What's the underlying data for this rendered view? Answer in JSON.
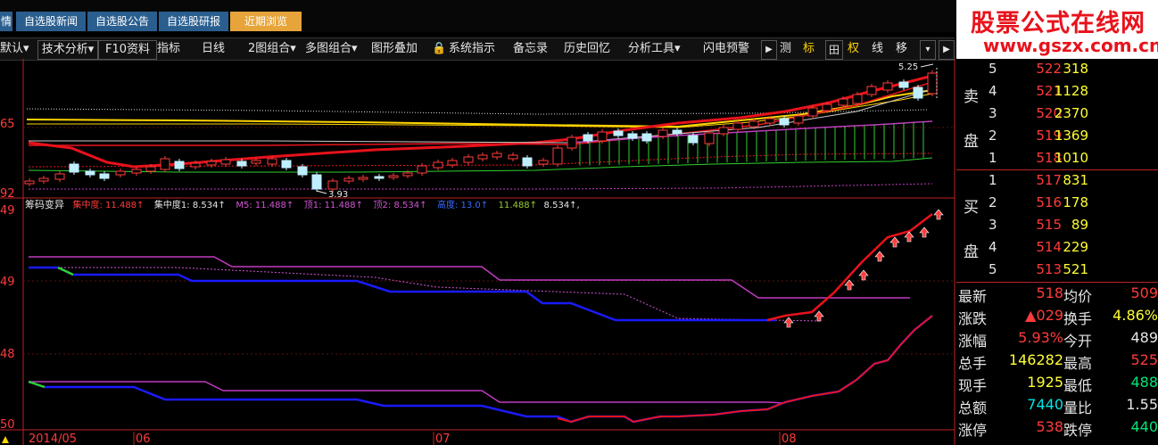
{
  "tabs": [
    {
      "label": "情"
    },
    {
      "label": "自选股新闻"
    },
    {
      "label": "自选股公告"
    },
    {
      "label": "自选股研报"
    },
    {
      "label": "近期浏览",
      "active": true
    }
  ],
  "toolbar": [
    {
      "label": "默认▾",
      "kind": "plain"
    },
    {
      "label": "技术分析▾",
      "kind": "plain"
    },
    {
      "label": "F10资料",
      "kind": "plain"
    },
    {
      "label": "指标",
      "kind": "plain"
    },
    {
      "label": "日线",
      "kind": "plain"
    },
    {
      "label": "2图组合▾",
      "kind": "plain"
    },
    {
      "label": "多图组合▾",
      "kind": "plain"
    },
    {
      "label": "图形叠加",
      "kind": "plain"
    },
    {
      "label": "🔒",
      "kind": "plain"
    },
    {
      "label": "系统指示",
      "kind": "plain"
    },
    {
      "label": "备忘录",
      "kind": "plain"
    },
    {
      "label": "历史回忆",
      "kind": "plain"
    },
    {
      "label": "分析工具▾",
      "kind": "plain"
    },
    {
      "label": "闪电预警",
      "kind": "plain"
    },
    {
      "label": "▶",
      "kind": "boxed"
    },
    {
      "label": "测",
      "kind": "plain"
    },
    {
      "label": "标",
      "kind": "hl"
    },
    {
      "label": "田",
      "kind": "boxed"
    },
    {
      "label": "权",
      "kind": "hl"
    },
    {
      "label": "线",
      "kind": "plain"
    },
    {
      "label": "移",
      "kind": "plain"
    },
    {
      "label": "▾",
      "kind": "boxed"
    },
    {
      "label": "▶",
      "kind": "boxed"
    }
  ],
  "watermark": {
    "title": "股票公式在线网",
    "url": "www.gszx.com.cn"
  },
  "price_chart": {
    "high_label": "5.25",
    "low_label": "3.93",
    "axis_labels": [
      "65",
      "92"
    ]
  },
  "indicator": {
    "name": "筹码变异",
    "legend": [
      {
        "text": "集中度: 11.488↑",
        "color": "#ff3b3b"
      },
      {
        "text": "集中度1: 8.534↑",
        "color": "#e6e6e6"
      },
      {
        "text": "M5: 11.488↑",
        "color": "#d256d2"
      },
      {
        "text": "顶1: 11.488↑",
        "color": "#d256d2"
      },
      {
        "text": "顶2: 8.534↑",
        "color": "#d256d2"
      },
      {
        "text": "高度: 13.0↑",
        "color": "#3b6bff"
      },
      {
        "text": "11.488↑",
        "color": "#9acd32"
      },
      {
        "text": "8.534↑,",
        "color": "#e6e6e6"
      }
    ],
    "axis_labels": [
      "49",
      "49",
      "48",
      "50"
    ]
  },
  "date_axis": [
    "2014/05",
    "06",
    "07",
    "08"
  ],
  "order_book": {
    "sell_label_top": "卖",
    "sell_label_bottom": "盘",
    "buy_label_top": "买",
    "buy_label_bottom": "盘",
    "sell": [
      {
        "level": "5",
        "price": "522",
        "volume": "318"
      },
      {
        "level": "4",
        "price": "521",
        "volume": "1128"
      },
      {
        "level": "3",
        "price": "520",
        "volume": "2370"
      },
      {
        "level": "2",
        "price": "519",
        "volume": "1369"
      },
      {
        "level": "1",
        "price": "518",
        "volume": "1010"
      }
    ],
    "buy": [
      {
        "level": "1",
        "price": "517",
        "volume": "831"
      },
      {
        "level": "2",
        "price": "516",
        "volume": "178"
      },
      {
        "level": "3",
        "price": "515",
        "volume": "89"
      },
      {
        "level": "4",
        "price": "514",
        "volume": "229"
      },
      {
        "level": "5",
        "price": "513",
        "volume": "521"
      }
    ]
  },
  "quote": [
    {
      "l1": "最新",
      "v1": "518",
      "c1": "#ff3b3b",
      "l2": "均价",
      "v2": "509",
      "c2": "#ff3b3b"
    },
    {
      "l1": "涨跌",
      "v1": "▲029",
      "c1": "#ff3b3b",
      "l2": "换手",
      "v2": "4.86%",
      "c2": "#ffff33"
    },
    {
      "l1": "涨幅",
      "v1": "5.93%",
      "c1": "#ff3b3b",
      "l2": "今开",
      "v2": "489",
      "c2": "#e6e6e6"
    },
    {
      "l1": "总手",
      "v1": "146282",
      "c1": "#ffff33",
      "l2": "最高",
      "v2": "525",
      "c2": "#ff3b3b"
    },
    {
      "l1": "现手",
      "v1": "1925",
      "c1": "#ffff33",
      "l2": "最低",
      "v2": "488",
      "c2": "#00e676"
    },
    {
      "l1": "总额",
      "v1": "7440",
      "c1": "#00e6e6",
      "l2": "量比",
      "v2": "1.55",
      "c2": "#e6e6e6"
    },
    {
      "l1": "涨停",
      "v1": "538",
      "c1": "#ff3b3b",
      "l2": "跌停",
      "v2": "440",
      "c2": "#00e676"
    }
  ]
}
